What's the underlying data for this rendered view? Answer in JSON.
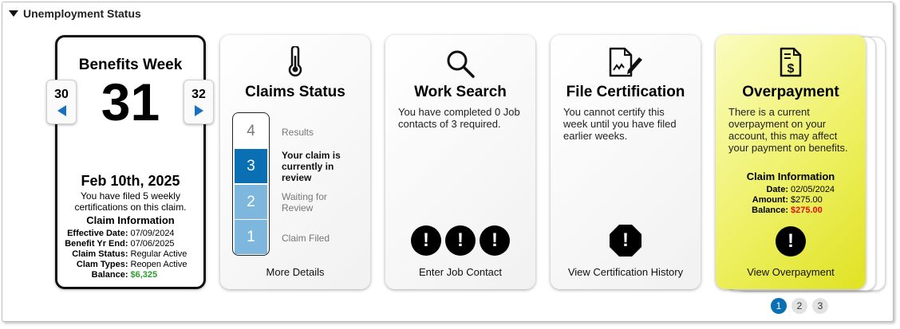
{
  "section": {
    "title": "Unemployment Status"
  },
  "benefits_week": {
    "title": "Benefits Week",
    "week": "31",
    "prev_week": "30",
    "next_week": "32",
    "date": "Feb 10th, 2025",
    "description": "You have filed 5 weekly certifications on this claim.",
    "info_title": "Claim Information",
    "info": [
      {
        "label": "Effective Date:",
        "value": "07/09/2024"
      },
      {
        "label": "Benefit Yr End:",
        "value": "07/06/2025"
      },
      {
        "label": "Claim Status:",
        "value": "Regular Active"
      },
      {
        "label": "Clam Types:",
        "value": "Reopen Active"
      },
      {
        "label": "Balance:",
        "value": "$6,325"
      }
    ],
    "balance_color": "#2e9b2e"
  },
  "claims_status": {
    "title": "Claims Status",
    "steps": [
      {
        "num": "4",
        "label": "Results"
      },
      {
        "num": "3",
        "label": "Your claim is currently in review"
      },
      {
        "num": "2",
        "label": "Waiting for Review"
      },
      {
        "num": "1",
        "label": "Claim Filed"
      }
    ],
    "link": "More Details",
    "active_color": "#0b6fb3",
    "done_color": "#7db7de"
  },
  "work_search": {
    "title": "Work Search",
    "text": "You have completed 0 Job contacts of 3 required.",
    "alerts": [
      "!",
      "!",
      "!"
    ],
    "link": "Enter Job Contact"
  },
  "file_certification": {
    "title": "File Certification",
    "text": "You cannot certify this week until you have filed earlier weeks.",
    "alert": "!",
    "link": "View Certification History"
  },
  "overpayment": {
    "title": "Overpayment",
    "text": "There is a current overpayment on your account, this may affect your payment on benefits.",
    "info_title": "Claim Information",
    "info": [
      {
        "label": "Date:",
        "value": "02/05/2024"
      },
      {
        "label": "Amount:",
        "value": "$275.00"
      },
      {
        "label": "Balance:",
        "value": "$275.00"
      }
    ],
    "balance_color": "#e01010",
    "alert": "!",
    "link": "View Overpayment",
    "bg_color": "#eef064"
  },
  "pager": {
    "pages": [
      "1",
      "2",
      "3"
    ],
    "current": "1",
    "accent": "#0b6fb3"
  },
  "icons": {
    "claims_status": "thermometer-icon",
    "work_search": "magnifier-icon",
    "file_certification": "document-pen-icon",
    "overpayment": "dollar-document-icon"
  }
}
